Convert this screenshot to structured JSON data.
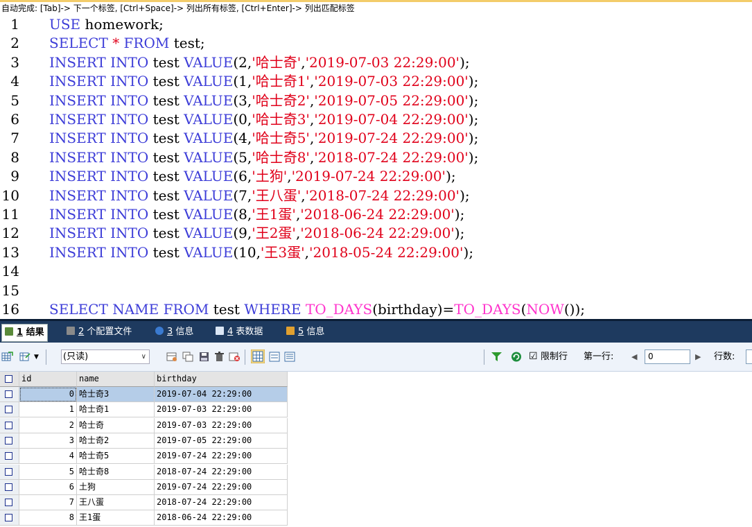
{
  "hint_bar": {
    "text": "自动完成: [Tab]-> 下一个标签, [Ctrl+Space]-> 列出所有标签, [Ctrl+Enter]-> 列出匹配标签"
  },
  "editor": {
    "lines": [
      {
        "num": "1",
        "tokens": [
          {
            "t": "USE",
            "c": "kw"
          },
          {
            "t": " homework;",
            "c": "tx"
          }
        ]
      },
      {
        "num": "2",
        "tokens": [
          {
            "t": "SELECT",
            "c": "kw"
          },
          {
            "t": " ",
            "c": "tx"
          },
          {
            "t": "*",
            "c": "st"
          },
          {
            "t": " ",
            "c": "tx"
          },
          {
            "t": "FROM",
            "c": "kw"
          },
          {
            "t": " test;",
            "c": "tx"
          }
        ]
      },
      {
        "num": "3",
        "tokens": [
          {
            "t": "INSERT",
            "c": "kw"
          },
          {
            "t": " ",
            "c": "tx"
          },
          {
            "t": "INTO",
            "c": "kw"
          },
          {
            "t": " test ",
            "c": "tx"
          },
          {
            "t": "VALUE",
            "c": "kw"
          },
          {
            "t": "(2,",
            "c": "pu"
          },
          {
            "t": "'哈士奇'",
            "c": "st"
          },
          {
            "t": ",",
            "c": "pu"
          },
          {
            "t": "'2019-07-03 22:29:00'",
            "c": "st"
          },
          {
            "t": ");",
            "c": "pu"
          }
        ]
      },
      {
        "num": "4",
        "tokens": [
          {
            "t": "INSERT",
            "c": "kw"
          },
          {
            "t": " ",
            "c": "tx"
          },
          {
            "t": "INTO",
            "c": "kw"
          },
          {
            "t": " test ",
            "c": "tx"
          },
          {
            "t": "VALUE",
            "c": "kw"
          },
          {
            "t": "(1,",
            "c": "pu"
          },
          {
            "t": "'哈士奇1'",
            "c": "st"
          },
          {
            "t": ",",
            "c": "pu"
          },
          {
            "t": "'2019-07-03 22:29:00'",
            "c": "st"
          },
          {
            "t": ");",
            "c": "pu"
          }
        ]
      },
      {
        "num": "5",
        "tokens": [
          {
            "t": "INSERT",
            "c": "kw"
          },
          {
            "t": " ",
            "c": "tx"
          },
          {
            "t": "INTO",
            "c": "kw"
          },
          {
            "t": " test ",
            "c": "tx"
          },
          {
            "t": "VALUE",
            "c": "kw"
          },
          {
            "t": "(3,",
            "c": "pu"
          },
          {
            "t": "'哈士奇2'",
            "c": "st"
          },
          {
            "t": ",",
            "c": "pu"
          },
          {
            "t": "'2019-07-05 22:29:00'",
            "c": "st"
          },
          {
            "t": ");",
            "c": "pu"
          }
        ]
      },
      {
        "num": "6",
        "tokens": [
          {
            "t": "INSERT",
            "c": "kw"
          },
          {
            "t": " ",
            "c": "tx"
          },
          {
            "t": "INTO",
            "c": "kw"
          },
          {
            "t": " test ",
            "c": "tx"
          },
          {
            "t": "VALUE",
            "c": "kw"
          },
          {
            "t": "(0,",
            "c": "pu"
          },
          {
            "t": "'哈士奇3'",
            "c": "st"
          },
          {
            "t": ",",
            "c": "pu"
          },
          {
            "t": "'2019-07-04 22:29:00'",
            "c": "st"
          },
          {
            "t": ");",
            "c": "pu"
          }
        ]
      },
      {
        "num": "7",
        "tokens": [
          {
            "t": "INSERT",
            "c": "kw"
          },
          {
            "t": " ",
            "c": "tx"
          },
          {
            "t": "INTO",
            "c": "kw"
          },
          {
            "t": " test ",
            "c": "tx"
          },
          {
            "t": "VALUE",
            "c": "kw"
          },
          {
            "t": "(4,",
            "c": "pu"
          },
          {
            "t": "'哈士奇5'",
            "c": "st"
          },
          {
            "t": ",",
            "c": "pu"
          },
          {
            "t": "'2019-07-24 22:29:00'",
            "c": "st"
          },
          {
            "t": ");",
            "c": "pu"
          }
        ]
      },
      {
        "num": "8",
        "tokens": [
          {
            "t": "INSERT",
            "c": "kw"
          },
          {
            "t": " ",
            "c": "tx"
          },
          {
            "t": "INTO",
            "c": "kw"
          },
          {
            "t": " test ",
            "c": "tx"
          },
          {
            "t": "VALUE",
            "c": "kw"
          },
          {
            "t": "(5,",
            "c": "pu"
          },
          {
            "t": "'哈士奇8'",
            "c": "st"
          },
          {
            "t": ",",
            "c": "pu"
          },
          {
            "t": "'2018-07-24 22:29:00'",
            "c": "st"
          },
          {
            "t": ");",
            "c": "pu"
          }
        ]
      },
      {
        "num": "9",
        "tokens": [
          {
            "t": "INSERT",
            "c": "kw"
          },
          {
            "t": " ",
            "c": "tx"
          },
          {
            "t": "INTO",
            "c": "kw"
          },
          {
            "t": " test ",
            "c": "tx"
          },
          {
            "t": "VALUE",
            "c": "kw"
          },
          {
            "t": "(6,",
            "c": "pu"
          },
          {
            "t": "'土狗'",
            "c": "st"
          },
          {
            "t": ",",
            "c": "pu"
          },
          {
            "t": "'2019-07-24 22:29:00'",
            "c": "st"
          },
          {
            "t": ");",
            "c": "pu"
          }
        ]
      },
      {
        "num": "10",
        "tokens": [
          {
            "t": "INSERT",
            "c": "kw"
          },
          {
            "t": " ",
            "c": "tx"
          },
          {
            "t": "INTO",
            "c": "kw"
          },
          {
            "t": " test ",
            "c": "tx"
          },
          {
            "t": "VALUE",
            "c": "kw"
          },
          {
            "t": "(7,",
            "c": "pu"
          },
          {
            "t": "'王八蛋'",
            "c": "st"
          },
          {
            "t": ",",
            "c": "pu"
          },
          {
            "t": "'2018-07-24 22:29:00'",
            "c": "st"
          },
          {
            "t": ");",
            "c": "pu"
          }
        ]
      },
      {
        "num": "11",
        "tokens": [
          {
            "t": "INSERT",
            "c": "kw"
          },
          {
            "t": " ",
            "c": "tx"
          },
          {
            "t": "INTO",
            "c": "kw"
          },
          {
            "t": " test ",
            "c": "tx"
          },
          {
            "t": "VALUE",
            "c": "kw"
          },
          {
            "t": "(8,",
            "c": "pu"
          },
          {
            "t": "'王1蛋'",
            "c": "st"
          },
          {
            "t": ",",
            "c": "pu"
          },
          {
            "t": "'2018-06-24 22:29:00'",
            "c": "st"
          },
          {
            "t": ");",
            "c": "pu"
          }
        ]
      },
      {
        "num": "12",
        "tokens": [
          {
            "t": "INSERT",
            "c": "kw"
          },
          {
            "t": " ",
            "c": "tx"
          },
          {
            "t": "INTO",
            "c": "kw"
          },
          {
            "t": " test ",
            "c": "tx"
          },
          {
            "t": "VALUE",
            "c": "kw"
          },
          {
            "t": "(9,",
            "c": "pu"
          },
          {
            "t": "'王2蛋'",
            "c": "st"
          },
          {
            "t": ",",
            "c": "pu"
          },
          {
            "t": "'2018-06-24 22:29:00'",
            "c": "st"
          },
          {
            "t": ");",
            "c": "pu"
          }
        ]
      },
      {
        "num": "13",
        "tokens": [
          {
            "t": "INSERT",
            "c": "kw"
          },
          {
            "t": " ",
            "c": "tx"
          },
          {
            "t": "INTO",
            "c": "kw"
          },
          {
            "t": " test ",
            "c": "tx"
          },
          {
            "t": "VALUE",
            "c": "kw"
          },
          {
            "t": "(10,",
            "c": "pu"
          },
          {
            "t": "'王3蛋'",
            "c": "st"
          },
          {
            "t": ",",
            "c": "pu"
          },
          {
            "t": "'2018-05-24 22:29:00'",
            "c": "st"
          },
          {
            "t": ");",
            "c": "pu"
          }
        ]
      },
      {
        "num": "14",
        "tokens": []
      },
      {
        "num": "15",
        "tokens": []
      },
      {
        "num": "16",
        "tokens": [
          {
            "t": "SELECT",
            "c": "kw"
          },
          {
            "t": " ",
            "c": "tx"
          },
          {
            "t": "NAME",
            "c": "kw"
          },
          {
            "t": " ",
            "c": "tx"
          },
          {
            "t": "FROM",
            "c": "kw"
          },
          {
            "t": " test ",
            "c": "tx"
          },
          {
            "t": "WHERE",
            "c": "kw"
          },
          {
            "t": " ",
            "c": "tx"
          },
          {
            "t": "TO_DAYS",
            "c": "fn"
          },
          {
            "t": "(birthday)=",
            "c": "pu"
          },
          {
            "t": "TO_DAYS",
            "c": "fn"
          },
          {
            "t": "(",
            "c": "pu"
          },
          {
            "t": "NOW",
            "c": "fn"
          },
          {
            "t": "());",
            "c": "pu"
          }
        ]
      }
    ]
  },
  "result_tabs": [
    {
      "num": "1",
      "label": "结果",
      "icon": "grid-icon",
      "active": true
    },
    {
      "num": "2",
      "label": "个配置文件",
      "icon": "profile-icon",
      "active": false
    },
    {
      "num": "3",
      "label": "信息",
      "icon": "info-icon",
      "active": false
    },
    {
      "num": "4",
      "label": "表数据",
      "icon": "table-data-icon",
      "active": false
    },
    {
      "num": "5",
      "label": "信息",
      "icon": "info2-icon",
      "active": false
    }
  ],
  "toolbar": {
    "mode_select": "(只读)",
    "limit_label": "限制行",
    "limit_checked": true,
    "first_row_label": "第一行:",
    "first_row_value": "0",
    "row_count_label": "行数:"
  },
  "grid": {
    "columns": [
      "id",
      "name",
      "birthday"
    ],
    "rows": [
      {
        "id": "0",
        "name": "哈士奇3",
        "birthday": "2019-07-04 22:29:00"
      },
      {
        "id": "1",
        "name": "哈士奇1",
        "birthday": "2019-07-03 22:29:00"
      },
      {
        "id": "2",
        "name": "哈士奇",
        "birthday": "2019-07-03 22:29:00"
      },
      {
        "id": "3",
        "name": "哈士奇2",
        "birthday": "2019-07-05 22:29:00"
      },
      {
        "id": "4",
        "name": "哈士奇5",
        "birthday": "2019-07-24 22:29:00"
      },
      {
        "id": "5",
        "name": "哈士奇8",
        "birthday": "2018-07-24 22:29:00"
      },
      {
        "id": "6",
        "name": "土狗",
        "birthday": "2019-07-24 22:29:00"
      },
      {
        "id": "7",
        "name": "王八蛋",
        "birthday": "2018-07-24 22:29:00"
      },
      {
        "id": "8",
        "name": "王1蛋",
        "birthday": "2018-06-24 22:29:00"
      }
    ]
  },
  "colors": {
    "keyword": "#3d3dd8",
    "function": "#ff33cc",
    "string": "#e0001a",
    "tabbar_bg": "#1e3a5f",
    "selected_row": "#b5cde8"
  }
}
